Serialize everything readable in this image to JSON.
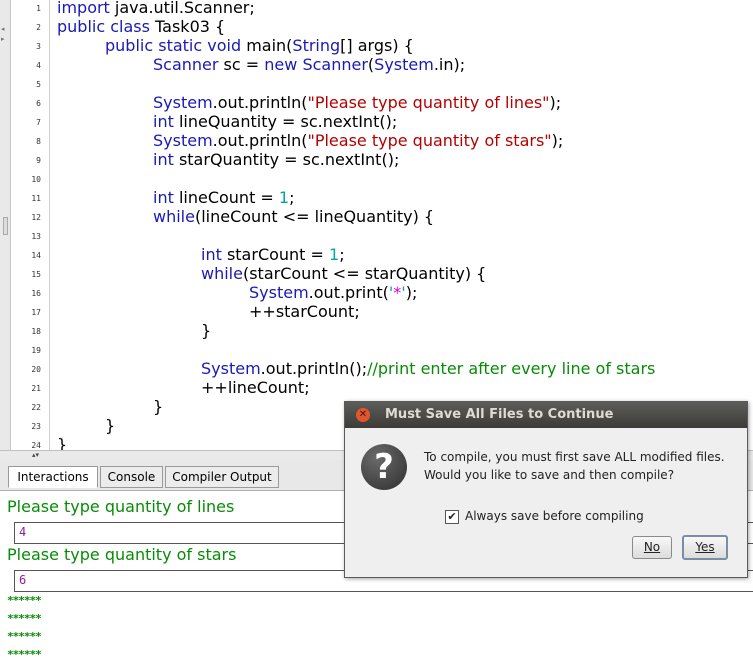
{
  "editor": {
    "line_numbers": [
      "1",
      "2",
      "3",
      "4",
      "5",
      "6",
      "7",
      "8",
      "9",
      "10",
      "11",
      "12",
      "13",
      "14",
      "15",
      "16",
      "17",
      "18",
      "19",
      "20",
      "21",
      "22",
      "23",
      "24"
    ],
    "code": {
      "l1_kw": "import",
      "l1_rest": " java.util.Scanner;",
      "l2_kw": "public class",
      "l2_rest": " Task03 {",
      "l3_kw1": "public static void",
      "l3_rest": " main(",
      "l3_kw2": "String",
      "l3_rest2": "[] args) {",
      "l4_kw1": "Scanner",
      "l4_mid": " sc = ",
      "l4_kw2": "new",
      "l4_sp": " ",
      "l4_kw3": "Scanner",
      "l4_p": "(",
      "l4_kw4": "System",
      "l4_end": ".in);",
      "l6_kw": "System",
      "l6_a": ".out.println(",
      "l6_str": "\"Please type quantity of lines\"",
      "l6_b": ");",
      "l7_kw": "int",
      "l7_rest": " lineQuantity = sc.nextInt();",
      "l8_kw": "System",
      "l8_a": ".out.println(",
      "l8_str": "\"Please type quantity of stars\"",
      "l8_b": ");",
      "l9_kw": "int",
      "l9_rest": " starQuantity = sc.nextInt();",
      "l11_kw": "int",
      "l11_a": " lineCount = ",
      "l11_num": "1",
      "l11_b": ";",
      "l12_kw": "while",
      "l12_rest": "(lineCount <= lineQuantity) {",
      "l14_kw": "int",
      "l14_a": " starCount = ",
      "l14_num": "1",
      "l14_b": ";",
      "l15_kw": "while",
      "l15_rest": "(starCount <= starQuantity) {",
      "l16_kw": "System",
      "l16_a": ".out.print(",
      "l16_q1": "'",
      "l16_star": "*",
      "l16_q2": "'",
      "l16_b": ");",
      "l17": "++starCount;",
      "l18": "}",
      "l20_kw": "System",
      "l20_a": ".out.println();",
      "l20_cm": "//print enter after every line of stars",
      "l21": "++lineCount;",
      "l22": "}",
      "l23": "}",
      "l24": "}"
    }
  },
  "tabs": [
    {
      "label": "Interactions"
    },
    {
      "label": "Console"
    },
    {
      "label": "Compiler Output"
    }
  ],
  "interactions": {
    "prompt1": "Please type quantity of lines",
    "input1": "4",
    "prompt2": "Please type quantity of stars",
    "input2": "6",
    "star_lines": [
      "******",
      "******",
      "******",
      "******"
    ]
  },
  "dialog": {
    "title": "Must Save All Files to Continue",
    "message_line1": "To compile, you must first save ALL modified files.",
    "message_line2": "Would you like to save and then compile?",
    "checkbox_label": "Always save before compiling",
    "checkbox_checked": true,
    "no_label": "No",
    "yes_label": "Yes",
    "question_glyph": "?",
    "close_glyph": "✕"
  },
  "colors": {
    "keyword": "#1a1ab4",
    "string": "#b50000",
    "number": "#00a6a6",
    "comment": "#078c07",
    "output": "#078c07",
    "input_value": "#8b1fa0"
  }
}
